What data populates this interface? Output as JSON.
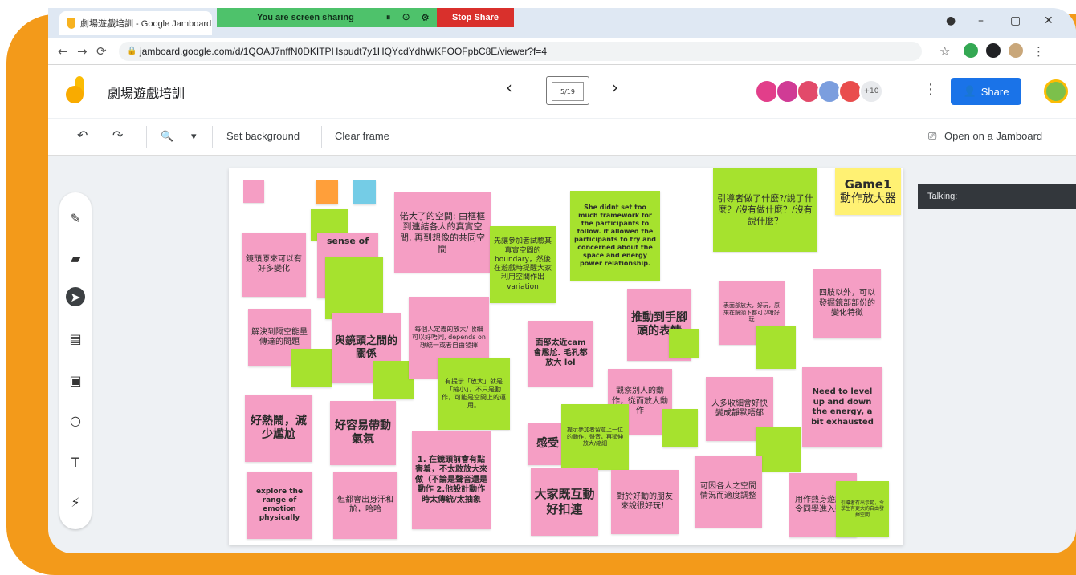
{
  "browser": {
    "tab_title": "劇場遊戲培訓 - Google Jamboard",
    "share_banner": "You are screen sharing",
    "stop_share": "Stop Share",
    "url": "jamboard.google.com/d/1QOAJ7nffN0DKITPHspudt7y1HQYcdYdhWKFOOFpbC8E/viewer?f=4"
  },
  "jamboard": {
    "title": "劇場遊戲培訓",
    "frame_indicator": "5/19",
    "more_collaborators": "+10",
    "share_label": "Share",
    "toolbar": {
      "zoom": "🔍",
      "set_background": "Set background",
      "clear_frame": "Clear frame",
      "open_on_jamboard": "Open on a Jamboard"
    },
    "talking_label": "Talking:"
  },
  "notes": [
    {
      "id": "n1",
      "color": "pink",
      "text": "鏡頭原來可以有好多變化"
    },
    {
      "id": "n2",
      "color": "pink",
      "text": "sense of"
    },
    {
      "id": "n3",
      "color": "pink",
      "text": "偌大了的空間: 由框框到連結各人的真實空間, 再到想像的共同空間"
    },
    {
      "id": "n4",
      "color": "green",
      "text": "先讓參加者試驗其真實空間的boundary，然後在遊戲時提醒大家利用空間作出variation"
    },
    {
      "id": "n5",
      "color": "green",
      "text": "She didnt set too much framework for the participants to follow. it allowed the participants to try and concerned about the space and energy power relationship."
    },
    {
      "id": "n6",
      "color": "green",
      "text": "引導者做了什麼?/說了什麼？/沒有做什麼？/沒有說什麼？"
    },
    {
      "id": "n7",
      "color": "yellow",
      "text": "Game1"
    },
    {
      "id": "n7b",
      "color": "yellow",
      "text": "動作放大器"
    },
    {
      "id": "n8",
      "color": "pink",
      "text": "解決到隔空能量傳達的問題"
    },
    {
      "id": "n9",
      "color": "pink",
      "text": "與鏡頭之間的關係"
    },
    {
      "id": "n10",
      "color": "pink",
      "text": "每個人定義的放大/ 收細可以好唔同, depends on 想統一或者自由發揮"
    },
    {
      "id": "n11",
      "color": "pink",
      "text": "面部太近cam 會尷尬. 毛孔都放大 lol"
    },
    {
      "id": "n12",
      "color": "pink",
      "text": "推動到手腳頭的表情"
    },
    {
      "id": "n13",
      "color": "pink",
      "text": "表面部放大，好玩，原來在鏡頭下都可以咁好玩"
    },
    {
      "id": "n14",
      "color": "pink",
      "text": "四肢以外，可以發掘鏡部部份的變化特徵"
    },
    {
      "id": "n15",
      "color": "green",
      "text": "有提示「放大」就是「縮小」，不只是動作，可能是空間上的運用。"
    },
    {
      "id": "n16",
      "color": "pink",
      "text": "觀察別人的動作，從而放大動作"
    },
    {
      "id": "n17",
      "color": "pink",
      "text": "人多收細會好快變成靜默唔郁"
    },
    {
      "id": "n18",
      "color": "pink",
      "text": "Need to level up and down the energy, a bit exhausted"
    },
    {
      "id": "n19",
      "color": "pink",
      "text": "好熱鬧，減少尷尬"
    },
    {
      "id": "n20",
      "color": "pink",
      "text": "好容易帶動氣氛"
    },
    {
      "id": "n21",
      "color": "pink",
      "text": "1. 在鏡頭前會有點害羞，不太敢放大來做（不論是聲音還是動作 2.他設計動作時太傳統/太抽象"
    },
    {
      "id": "n22",
      "color": "pink",
      "text": "感受"
    },
    {
      "id": "n23",
      "color": "green",
      "text": "提示參加者留意上一位的動作，聲音，再延伸放大/縮細"
    },
    {
      "id": "n24",
      "color": "pink",
      "text": "大家既互動好扣連"
    },
    {
      "id": "n25",
      "color": "pink",
      "text": "對於好動的朋友來說很好玩！"
    },
    {
      "id": "n26",
      "color": "pink",
      "text": "可因各人之空間情況而適度調整"
    },
    {
      "id": "n27",
      "color": "pink",
      "text": "用作熱身遊戲，令同學進入狀態"
    },
    {
      "id": "n28",
      "color": "pink",
      "text": "explore the range of emotion physically"
    },
    {
      "id": "n29",
      "color": "pink",
      "text": "但都會出身汗和尬，哈哈"
    },
    {
      "id": "n30",
      "color": "green",
      "text": "引導者冇出示範，令學生有更大的自由發揮空間"
    }
  ]
}
